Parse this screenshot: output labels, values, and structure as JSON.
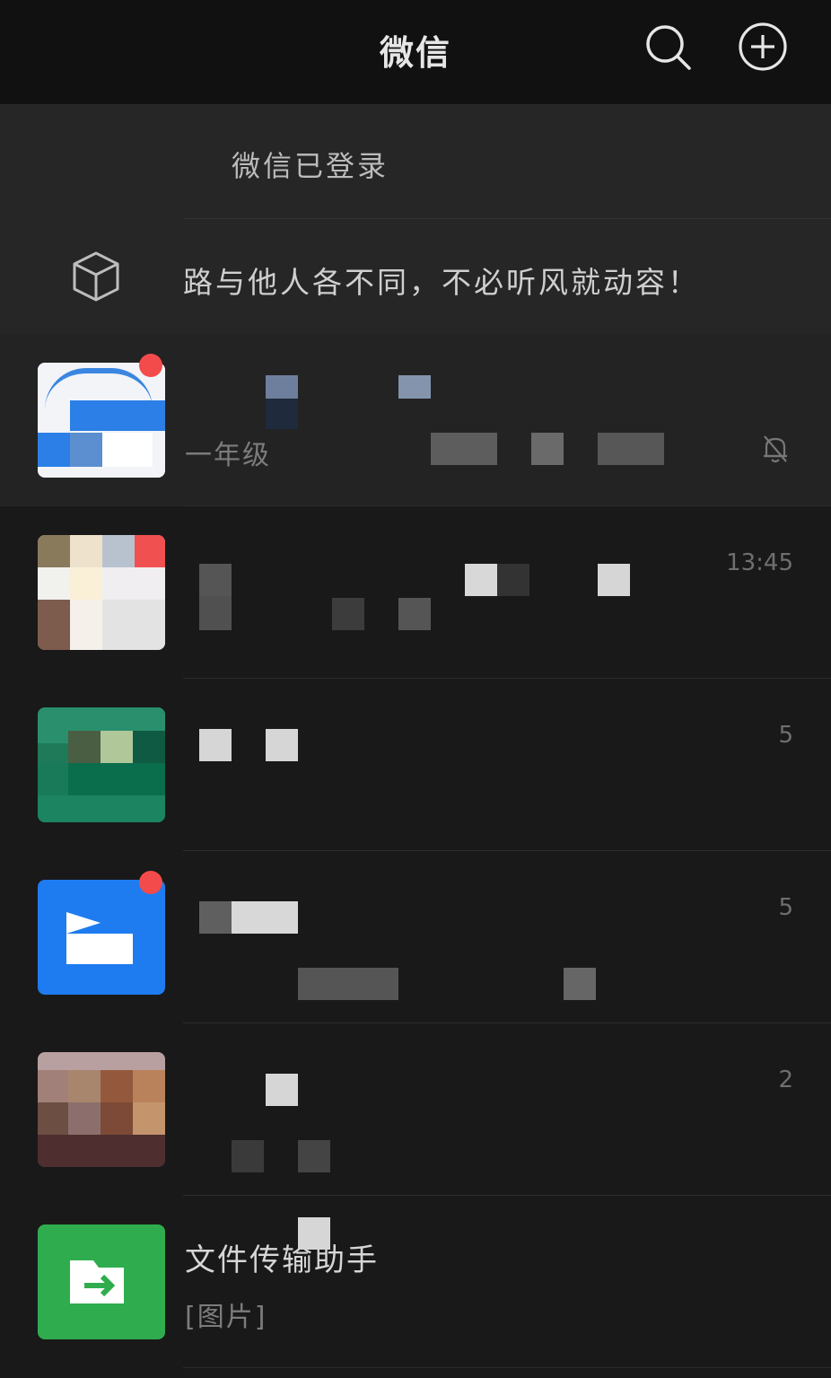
{
  "header": {
    "title": "微信",
    "search_icon": "search-icon",
    "add_icon": "plus-circle-icon"
  },
  "top_panel": {
    "login_text": "微信已登录",
    "status_icon": "cube-icon",
    "status_text": "路与他人各不同，不必听风就动容！"
  },
  "chats": [
    {
      "name": "",
      "preview": "一年级",
      "time": "",
      "muted": true,
      "unread": true,
      "pinned": true,
      "avatar_color": "#2b7fe6"
    },
    {
      "name": "",
      "preview": "",
      "time": "13:45",
      "muted": false,
      "unread": false,
      "pinned": false,
      "avatar_color": "#c8b8a8"
    },
    {
      "name": "",
      "preview": "",
      "time": "5",
      "muted": false,
      "unread": false,
      "pinned": false,
      "avatar_color": "#1f7a5a"
    },
    {
      "name": "",
      "preview": "",
      "time": "5",
      "muted": false,
      "unread": true,
      "pinned": false,
      "avatar_color": "#1e7cf0"
    },
    {
      "name": "",
      "preview": "",
      "time": "2",
      "muted": false,
      "unread": false,
      "pinned": false,
      "avatar_color": "#8a6a5a"
    },
    {
      "name": "文件传输助手",
      "preview": "[图片]",
      "time": "",
      "muted": false,
      "unread": false,
      "pinned": false,
      "avatar_color": "#2fad4e"
    }
  ],
  "colors": {
    "header_bg": "#111111",
    "panel_bg": "#262626",
    "list_bg": "#191919",
    "badge_red": "#f34b4b"
  }
}
